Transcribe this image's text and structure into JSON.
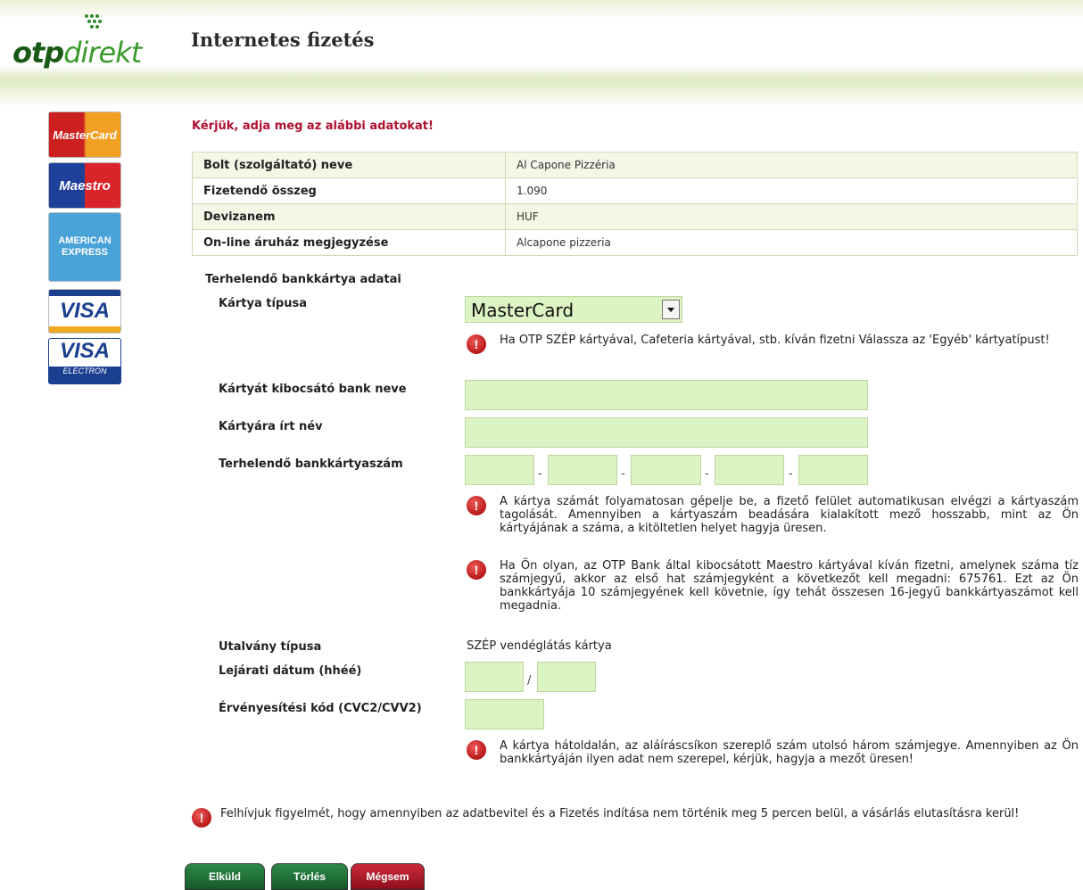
{
  "header": {
    "logo_otp": "otp",
    "logo_direkt": "direkt",
    "title": "Internetes fizetés"
  },
  "cards": {
    "mastercard": "MasterCard",
    "maestro": "Maestro",
    "amex": "AMERICAN EXPRESS",
    "visa": "VISA",
    "visa_electron": "VISA",
    "visa_electron_sub": "ELECTRON"
  },
  "instruction": "Kérjük, adja meg az alábbi adatokat!",
  "info_rows": [
    {
      "label": "Bolt (szolgáltató) neve",
      "value": "Al Capone Pizzéria"
    },
    {
      "label": "Fizetendő összeg",
      "value": "1.090"
    },
    {
      "label": "Devizanem",
      "value": "HUF"
    },
    {
      "label": "On-line áruház megjegyzése",
      "value": "Alcapone pizzeria"
    }
  ],
  "form": {
    "section_title": "Terhelendő bankkártya adatai",
    "card_type_label": "Kártya típusa",
    "card_type_value": "MasterCard",
    "card_type_warning": "Ha OTP SZÉP kártyával, Cafeteria kártyával, stb. kíván fizetni Válassza az 'Egyéb' kártyatípust!",
    "issuer_label": "Kártyát kibocsátó bank neve",
    "name_label": "Kártyára írt név",
    "number_label": "Terhelendő bankkártyaszám",
    "number_sep": "-",
    "number_warning_1": "A kártya számát folyamatosan gépelje be, a fizető felület automatikusan elvégzi a kártyaszám tagolását. Amennyiben a kártyaszám beadására kialakított mező hosszabb, mint az Ön kártyájának a száma, a kitöltetlen helyet hagyja üresen.",
    "number_warning_2": "Ha Ön olyan, az OTP Bank által kibocsátott Maestro kártyával kíván fizetni, amelynek száma tíz számjegyű, akkor az első hat számjegyként a következőt kell megadni: 675761. Ezt az Ön bankkártyája 10 számjegyének kell követnie, így tehát összesen 16-jegyű bankkártyaszámot kell megadnia.",
    "voucher_label": "Utalvány típusa",
    "voucher_value": "SZÉP vendéglátás kártya",
    "expiry_label": "Lejárati dátum (hhéé)",
    "expiry_sep": "/",
    "cvc_label": "Érvényesítési kód (CVC2/CVV2)",
    "cvc_warning": "A kártya hátoldalán, az aláíráscsíkon szereplő szám utolsó három számjegye. Amennyiben az Ön bankkártyáján ilyen adat nem szerepel, kérjük, hagyja a mezőt üresen!"
  },
  "timeout_note": "Felhívjuk figyelmét, hogy amennyiben az adatbevitel és a Fizetés indítása nem történik meg 5 percen belül, a vásárlás elutasításra kerül!",
  "buttons": {
    "submit": "Elküld",
    "clear": "Törlés",
    "cancel": "Mégsem"
  },
  "warning_icon_glyph": "!"
}
